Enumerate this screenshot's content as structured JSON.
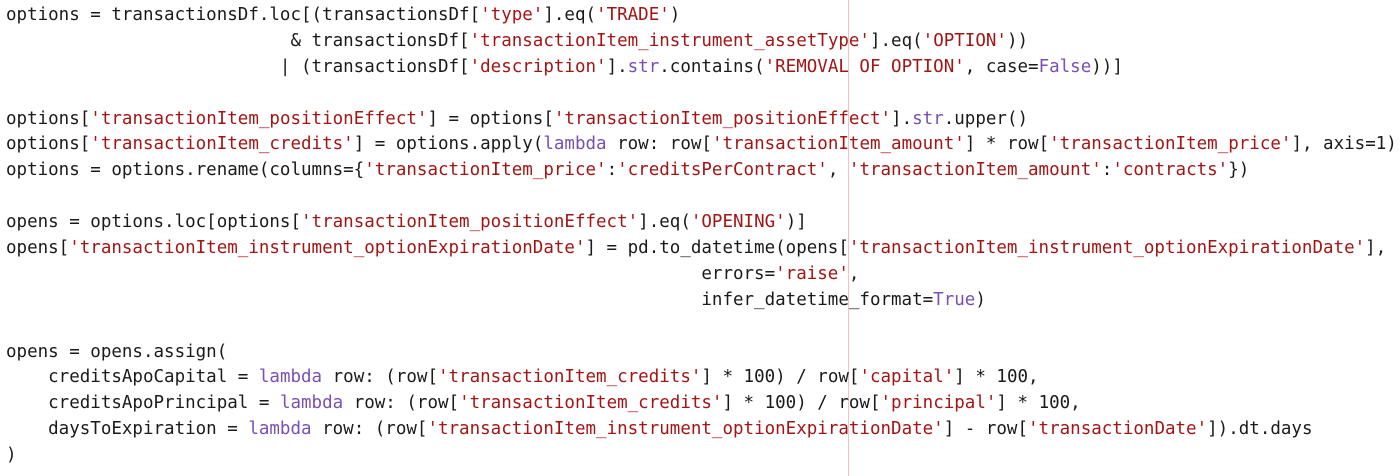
{
  "editor": {
    "lines": [
      [
        [
          "t",
          "options = transactionsDf.loc[(transactionsDf["
        ],
        [
          "s",
          "'type'"
        ],
        [
          "t",
          "].eq("
        ],
        [
          "s",
          "'TRADE'"
        ],
        [
          "t",
          ")"
        ]
      ],
      [
        [
          "t",
          "                           & transactionsDf["
        ],
        [
          "s",
          "'transactionItem_instrument_assetType'"
        ],
        [
          "t",
          "].eq("
        ],
        [
          "s",
          "'OPTION'"
        ],
        [
          "t",
          "))"
        ]
      ],
      [
        [
          "t",
          "                          | (transactionsDf["
        ],
        [
          "s",
          "'description'"
        ],
        [
          "t",
          "]."
        ],
        [
          "k",
          "str"
        ],
        [
          "t",
          ".contains("
        ],
        [
          "s",
          "'REMOVAL OF OPTION'"
        ],
        [
          "t",
          ", case="
        ],
        [
          "k",
          "False"
        ],
        [
          "t",
          "))]"
        ]
      ],
      [],
      [
        [
          "t",
          "options["
        ],
        [
          "s",
          "'transactionItem_positionEffect'"
        ],
        [
          "t",
          "] = options["
        ],
        [
          "s",
          "'transactionItem_positionEffect'"
        ],
        [
          "t",
          "]."
        ],
        [
          "k",
          "str"
        ],
        [
          "t",
          ".upper()"
        ]
      ],
      [
        [
          "t",
          "options["
        ],
        [
          "s",
          "'transactionItem_credits'"
        ],
        [
          "t",
          "] = options.apply("
        ],
        [
          "k",
          "lambda"
        ],
        [
          "t",
          " row: row["
        ],
        [
          "s",
          "'transactionItem_amount'"
        ],
        [
          "t",
          "] * row["
        ],
        [
          "s",
          "'transactionItem_price'"
        ],
        [
          "t",
          "], axis=1)"
        ]
      ],
      [
        [
          "t",
          "options = options.rename(columns={"
        ],
        [
          "s",
          "'transactionItem_price'"
        ],
        [
          "t",
          ":"
        ],
        [
          "s",
          "'creditsPerContract'"
        ],
        [
          "t",
          ", "
        ],
        [
          "s",
          "'transactionItem_amount'"
        ],
        [
          "t",
          ":"
        ],
        [
          "s",
          "'contracts'"
        ],
        [
          "t",
          "})"
        ]
      ],
      [],
      [
        [
          "t",
          "opens = options.loc[options["
        ],
        [
          "s",
          "'transactionItem_positionEffect'"
        ],
        [
          "t",
          "].eq("
        ],
        [
          "s",
          "'OPENING'"
        ],
        [
          "t",
          ")]"
        ]
      ],
      [
        [
          "t",
          "opens["
        ],
        [
          "s",
          "'transactionItem_instrument_optionExpirationDate'"
        ],
        [
          "t",
          "] = pd.to_datetime(opens["
        ],
        [
          "s",
          "'transactionItem_instrument_optionExpirationDate'"
        ],
        [
          "t",
          "],"
        ]
      ],
      [
        [
          "t",
          "                                                                  errors="
        ],
        [
          "s",
          "'raise'"
        ],
        [
          "t",
          ","
        ]
      ],
      [
        [
          "t",
          "                                                                  infer_datetime_format="
        ],
        [
          "k",
          "True"
        ],
        [
          "t",
          ")"
        ]
      ],
      [],
      [
        [
          "t",
          "opens = opens.assign("
        ]
      ],
      [
        [
          "t",
          "    creditsApoCapital = "
        ],
        [
          "k",
          "lambda"
        ],
        [
          "t",
          " row: (row["
        ],
        [
          "s",
          "'transactionItem_credits'"
        ],
        [
          "t",
          "] * 100) / row["
        ],
        [
          "s",
          "'capital'"
        ],
        [
          "t",
          "] * 100,"
        ]
      ],
      [
        [
          "t",
          "    creditsApoPrincipal = "
        ],
        [
          "k",
          "lambda"
        ],
        [
          "t",
          " row: (row["
        ],
        [
          "s",
          "'transactionItem_credits'"
        ],
        [
          "t",
          "] * 100) / row["
        ],
        [
          "s",
          "'principal'"
        ],
        [
          "t",
          "] * 100,"
        ]
      ],
      [
        [
          "t",
          "    daysToExpiration = "
        ],
        [
          "k",
          "lambda"
        ],
        [
          "t",
          " row: (row["
        ],
        [
          "s",
          "'transactionItem_instrument_optionExpirationDate'"
        ],
        [
          "t",
          "] - row["
        ],
        [
          "s",
          "'transactionDate'"
        ],
        [
          "t",
          "]).dt.days"
        ]
      ],
      [
        [
          "t",
          ")"
        ]
      ]
    ],
    "colors": {
      "text": "#1a1a1a",
      "string": "#a31515",
      "keyword": "#7a4fb3",
      "ruler": "#f0c4c4",
      "background": "#ffffff"
    }
  }
}
